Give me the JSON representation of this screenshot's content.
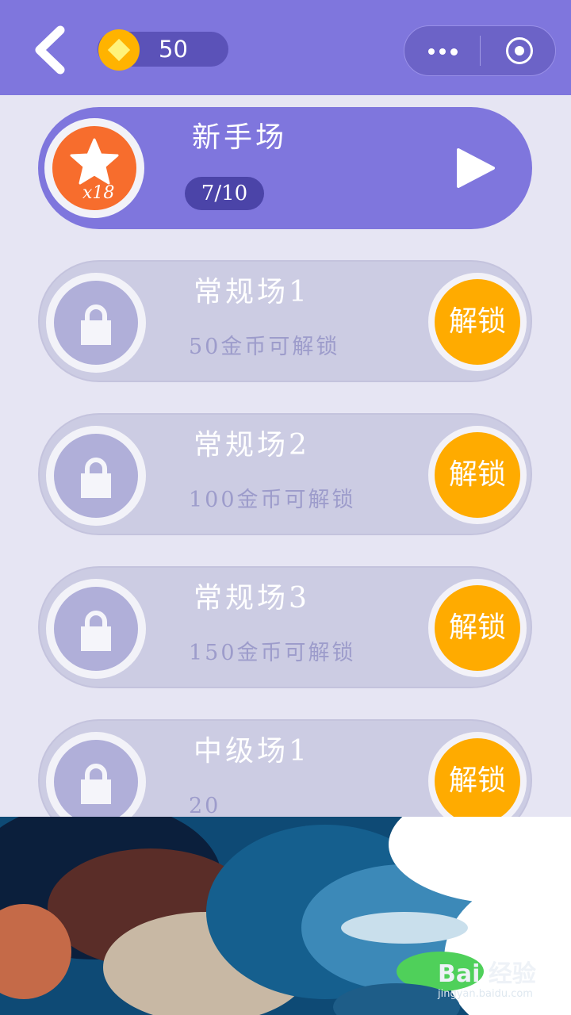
{
  "header": {
    "coins": "50",
    "back_icon": "back-chevron-icon",
    "coin_icon": "coin-diamond-icon",
    "more_icon": "more-dots-icon",
    "close_icon": "target-circle-icon"
  },
  "levels": [
    {
      "title": "新手场",
      "progress": "7/10",
      "multiplier": "x18",
      "state": "active"
    },
    {
      "title": "常规场1",
      "subtitle": "50金币可解锁",
      "action": "解锁",
      "state": "locked"
    },
    {
      "title": "常规场2",
      "subtitle": "100金币可解锁",
      "action": "解锁",
      "state": "locked"
    },
    {
      "title": "常规场3",
      "subtitle": "150金币可解锁",
      "action": "解锁",
      "state": "locked"
    },
    {
      "title": "中级场1",
      "subtitle": "20",
      "action": "解锁",
      "state": "locked"
    }
  ],
  "watermark": {
    "brand": "Bai",
    "brand_cn": "经验",
    "url": "jingyan.baidu.com"
  },
  "colors": {
    "header": "#7f76dd",
    "unlock_button": "#ffab00",
    "star_badge": "#f76d2d"
  }
}
